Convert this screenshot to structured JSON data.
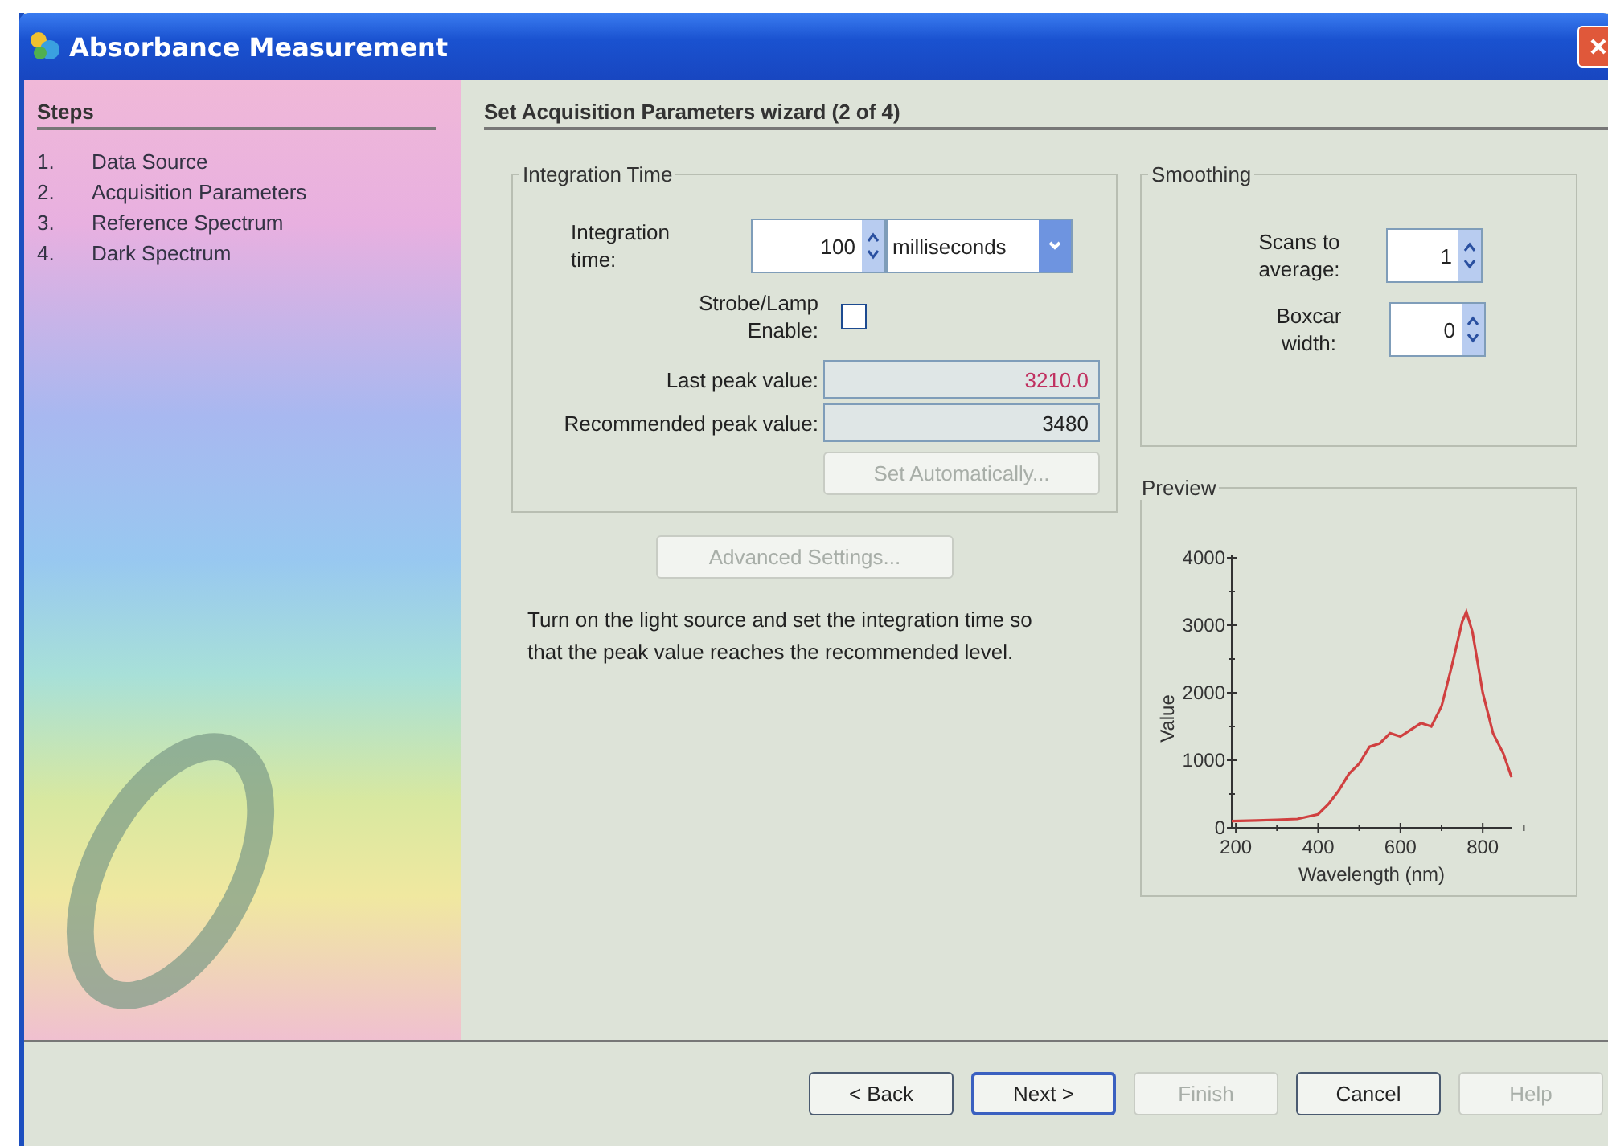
{
  "window": {
    "title": "Absorbance Measurement"
  },
  "steps": {
    "title": "Steps",
    "items": [
      {
        "number": "1.",
        "label": "Data Source"
      },
      {
        "number": "2.",
        "label": "Acquisition Parameters"
      },
      {
        "number": "3.",
        "label": "Reference Spectrum"
      },
      {
        "number": "4.",
        "label": "Dark Spectrum"
      }
    ]
  },
  "wizard": {
    "title": "Set Acquisition Parameters wizard (2 of 4)"
  },
  "integration": {
    "title": "Integration Time",
    "time_label": "Integration time:",
    "time_value": "100",
    "unit": "milliseconds",
    "strobe_label": "Strobe/Lamp Enable:",
    "strobe_checked": false,
    "last_peak_label": "Last peak value:",
    "last_peak_value": "3210.0",
    "recommended_label": "Recommended peak value:",
    "recommended_value": "3480",
    "auto_button": {
      "label": "Set Automatically...",
      "disabled": true
    }
  },
  "advanced_button": {
    "label": "Advanced Settings...",
    "disabled": true
  },
  "instructions": "Turn on the light source and set the integration time so that the peak value reaches the recommended level.",
  "smoothing": {
    "title": "Smoothing",
    "fields": [
      {
        "label": "Scans to average:",
        "value": "1"
      },
      {
        "label": "Boxcar width:",
        "value": "0"
      }
    ]
  },
  "preview": {
    "title": "Preview",
    "chart_data": {
      "type": "line",
      "xlabel": "Wavelength (nm)",
      "ylabel": "Value",
      "xticks": [
        200,
        400,
        600,
        800
      ],
      "yticks": [
        0,
        1000,
        2000,
        3000,
        4000
      ],
      "xlim": [
        190,
        870
      ],
      "ylim": [
        0,
        4000
      ],
      "x": [
        190,
        250,
        300,
        350,
        400,
        425,
        450,
        475,
        500,
        525,
        550,
        575,
        600,
        625,
        650,
        675,
        700,
        725,
        750,
        760,
        775,
        800,
        825,
        850,
        870
      ],
      "series": [
        {
          "color": "#d04040",
          "values": [
            100,
            110,
            120,
            130,
            200,
            350,
            550,
            800,
            950,
            1200,
            1250,
            1400,
            1350,
            1450,
            1550,
            1500,
            1800,
            2400,
            3050,
            3200,
            2900,
            2000,
            1400,
            1100,
            750
          ]
        }
      ]
    }
  },
  "buttons": [
    {
      "label": "< Back",
      "disabled": false,
      "default": false
    },
    {
      "label": "Next >",
      "disabled": false,
      "default": true
    },
    {
      "label": "Finish",
      "disabled": true,
      "default": false
    },
    {
      "label": "Cancel",
      "disabled": false,
      "default": false
    },
    {
      "label": "Help",
      "disabled": true,
      "default": false
    }
  ]
}
